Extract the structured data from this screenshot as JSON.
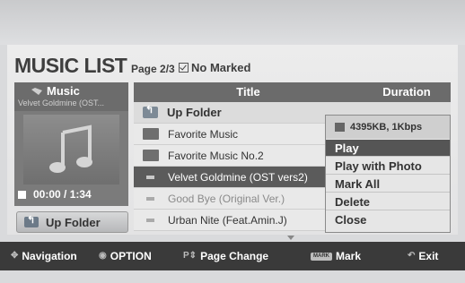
{
  "header": {
    "title": "MUSIC LIST",
    "page": "Page 2/3",
    "marked": "No Marked"
  },
  "left_panel": {
    "label": "Music",
    "now_playing": "Velvet Goldmine (OST...",
    "time": "00:00 / 1:34",
    "up_folder_label": "Up Folder"
  },
  "table": {
    "col_title": "Title",
    "col_duration": "Duration",
    "rows": [
      {
        "label": "Up Folder",
        "type": "up-folder"
      },
      {
        "label": "Favorite Music",
        "type": "folder"
      },
      {
        "label": "Favorite Music No.2",
        "type": "folder"
      },
      {
        "label": "Velvet Goldmine (OST vers2)",
        "type": "file",
        "selected": true
      },
      {
        "label": "Good Bye (Original Ver.)",
        "type": "file",
        "dim": true
      },
      {
        "label": "Urban Nite (Feat.Amin.J)",
        "type": "file"
      }
    ]
  },
  "popup": {
    "info": "4395KB, 1Kbps",
    "items": [
      "Play",
      "Play with Photo",
      "Mark All",
      "Delete",
      "Close"
    ],
    "active": "Play"
  },
  "footer": {
    "navigation": "Navigation",
    "option": "OPTION",
    "page_change": "Page Change",
    "mark_key": "MARK",
    "mark": "Mark",
    "exit": "Exit"
  },
  "colors": {
    "selected_row": "#5b5b5b",
    "header_bg": "#6b6b6b",
    "footer_bg": "#3a3a3a"
  }
}
